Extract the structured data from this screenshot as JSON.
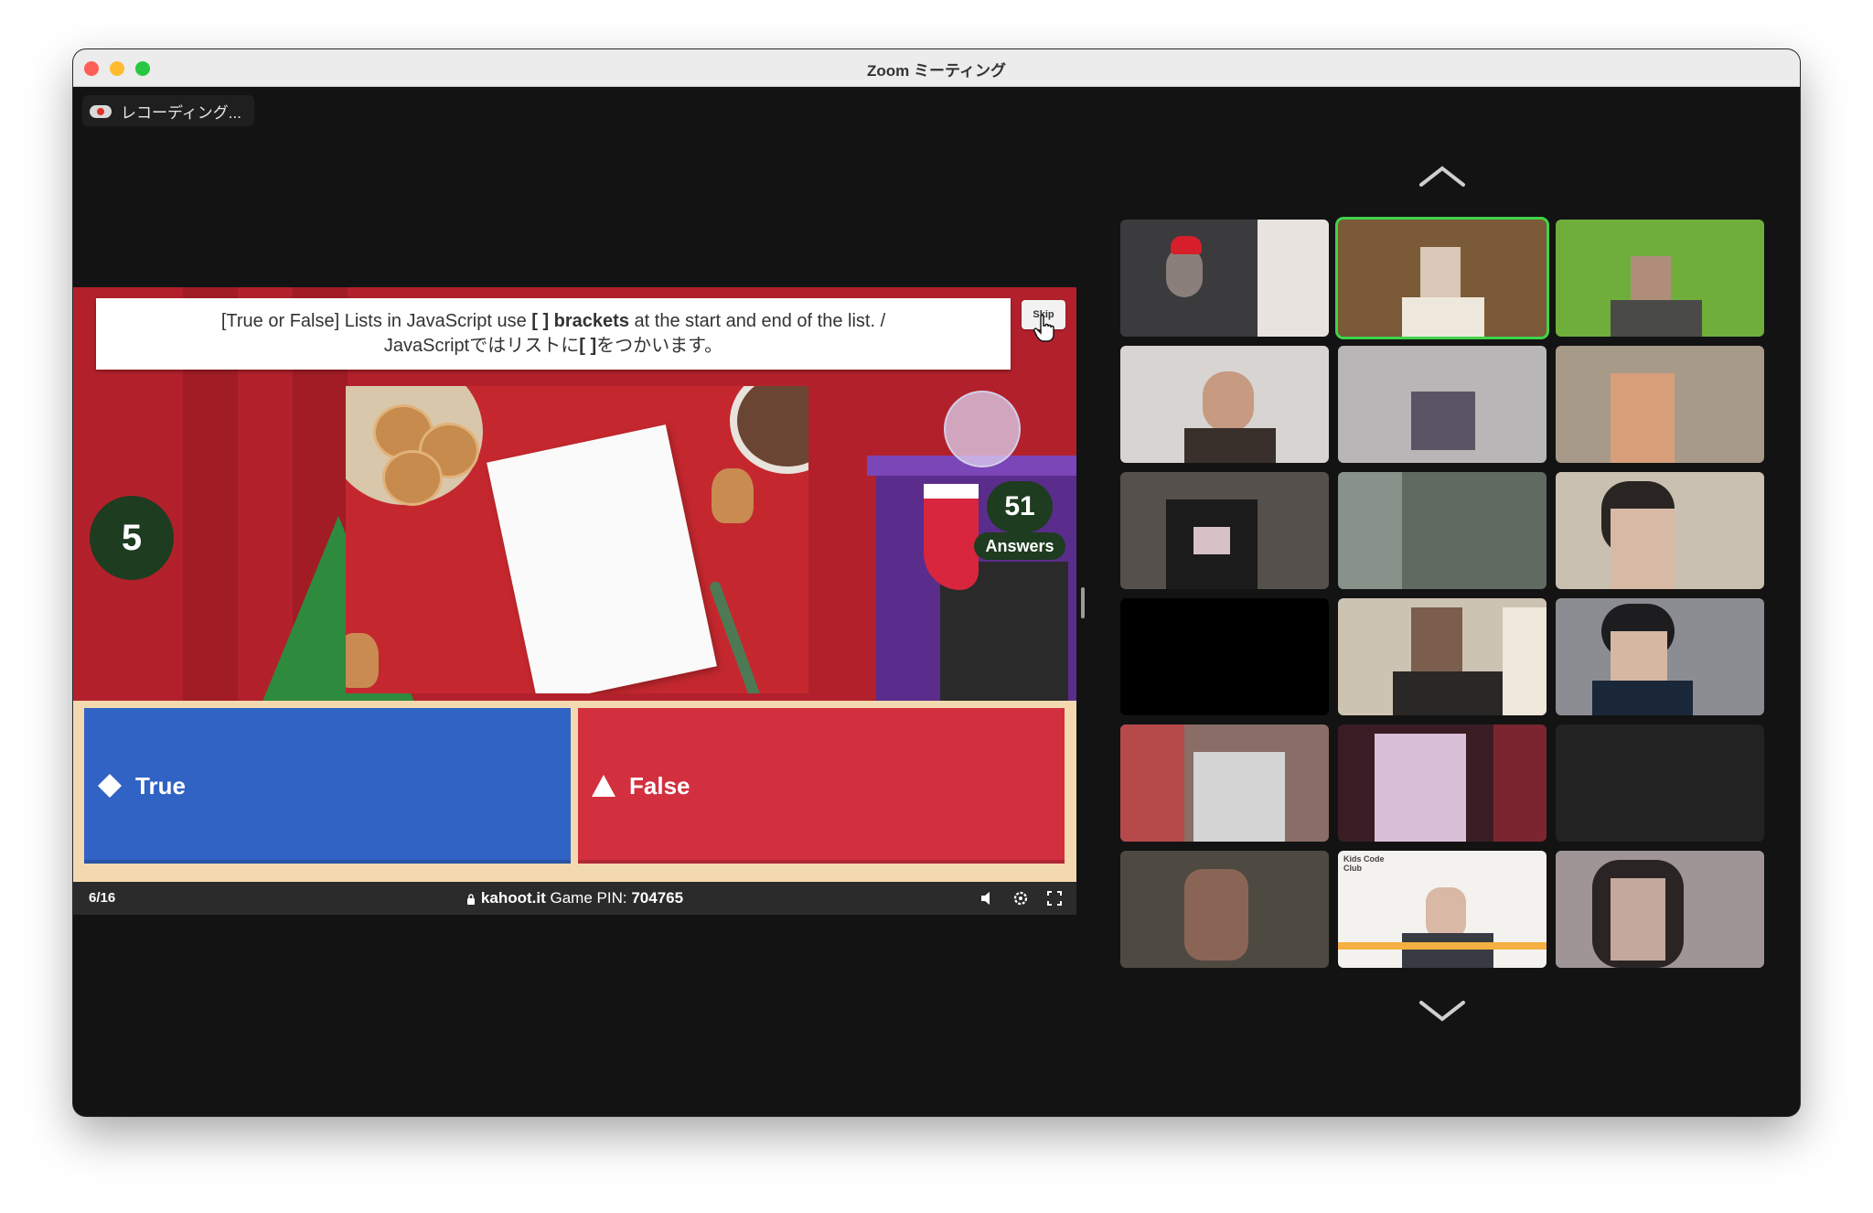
{
  "window": {
    "title": "Zoom ミーティング",
    "recording_label": "レコーディング..."
  },
  "kahoot": {
    "question_line1_a": "[True or False] Lists in JavaScript use ",
    "question_line1_bold": "[ ] brackets",
    "question_line1_b": " at the start and end of the list. /",
    "question_line2_a": "JavaScript",
    "question_line2_b": "ではリストに",
    "question_line2_bold": "[ ]",
    "question_line2_c": "をつかいます。",
    "skip_label": "Skip",
    "timer": "5",
    "answers_count": "51",
    "answers_label": "Answers",
    "answer_true": "True",
    "answer_false": "False",
    "progress": "6/16",
    "site": "kahoot.it",
    "pin_label": "Game PIN:",
    "pin_value": "704765"
  },
  "participants": {
    "tiles": [
      {
        "bg": "#3b3a3d",
        "active": false
      },
      {
        "bg": "#7a5a37",
        "active": true
      },
      {
        "bg": "#6fae3a",
        "active": false
      },
      {
        "bg": "#d8d4d2",
        "active": false
      },
      {
        "bg": "#b8b6b7",
        "active": false
      },
      {
        "bg": "#a89a88",
        "active": false
      },
      {
        "bg": "#55504c",
        "active": false
      },
      {
        "bg": "#5f6a61",
        "active": false
      },
      {
        "bg": "#c9c0b1",
        "active": false
      },
      {
        "bg": "#000000",
        "active": false
      },
      {
        "bg": "#cdc3b3",
        "active": false
      },
      {
        "bg": "#8b8d92",
        "active": false
      },
      {
        "bg": "#8a6d66",
        "active": false
      },
      {
        "bg": "#3a1d24",
        "active": false
      },
      {
        "bg": "#222222",
        "active": false
      },
      {
        "bg": "#4e4a41",
        "active": false
      },
      {
        "bg": "#f4f2ee",
        "active": false
      },
      {
        "bg": "#9f9496",
        "active": false
      }
    ],
    "logo_text": "Kids Code Club"
  }
}
